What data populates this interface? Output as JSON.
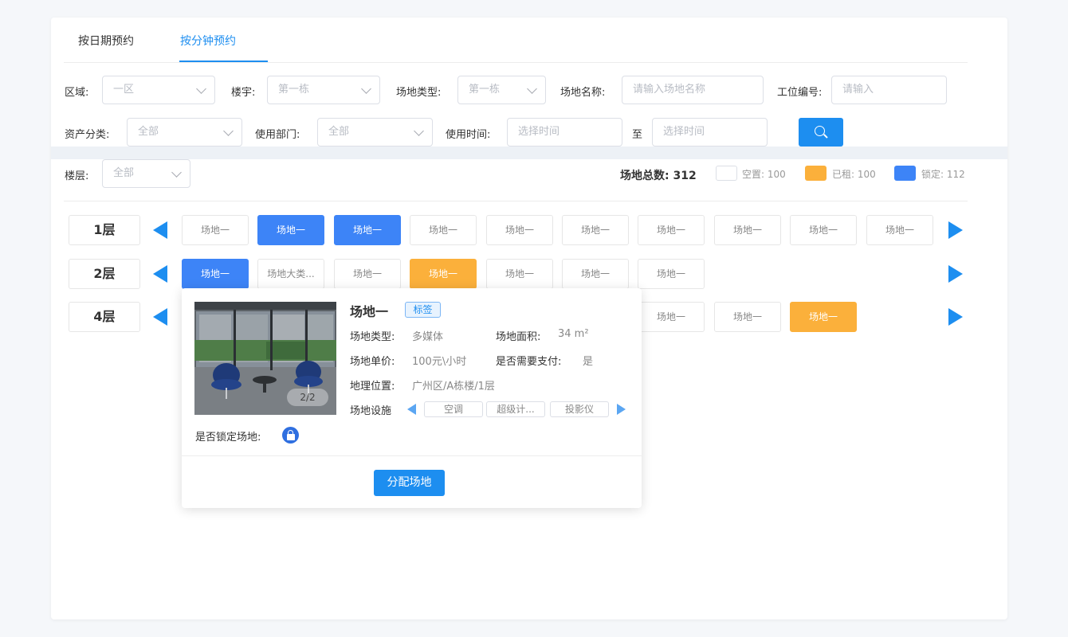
{
  "tabs": [
    "按日期预约",
    "按分钟预约"
  ],
  "filters": {
    "area": {
      "label": "区域:",
      "value": "一区"
    },
    "building": {
      "label": "楼宇:",
      "value": "第一栋"
    },
    "venue_type": {
      "label": "场地类型:",
      "value": "第一栋"
    },
    "venue_name": {
      "label": "场地名称:",
      "placeholder": "请输入场地名称"
    },
    "station_no": {
      "label": "工位编号:",
      "placeholder": "请输入"
    },
    "asset_class": {
      "label": "资产分类:",
      "value": "全部"
    },
    "department": {
      "label": "使用部门:",
      "value": "全部"
    },
    "use_time": {
      "label": "使用时间:",
      "start_placeholder": "选择时间",
      "to": "至",
      "end_placeholder": "选择时间"
    },
    "floor": {
      "label": "楼层:",
      "value": "全部"
    }
  },
  "icons": {
    "search": "search-icon",
    "lock": "lock-icon",
    "chevron": "chevron-down-icon"
  },
  "legend": {
    "total_label": "场地总数: 312",
    "free": "空置: 100",
    "rented": "已租: 100",
    "locked": "锁定: 112"
  },
  "colors": {
    "accent": "#1d8ef0",
    "locked": "#3d84f7",
    "rented": "#fbb03b",
    "free": "#ffffff"
  },
  "floors": [
    {
      "label": "1层",
      "rooms": [
        {
          "name": "场地一",
          "state": "free"
        },
        {
          "name": "场地一",
          "state": "locked"
        },
        {
          "name": "场地一",
          "state": "locked"
        },
        {
          "name": "场地一",
          "state": "free"
        },
        {
          "name": "场地一",
          "state": "free"
        },
        {
          "name": "场地一",
          "state": "free"
        },
        {
          "name": "场地一",
          "state": "free"
        },
        {
          "name": "场地一",
          "state": "free"
        },
        {
          "name": "场地一",
          "state": "free"
        },
        {
          "name": "场地一",
          "state": "free"
        }
      ]
    },
    {
      "label": "2层",
      "rooms": [
        {
          "name": "场地一",
          "state": "locked"
        },
        {
          "name": "场地大类...",
          "state": "free"
        },
        {
          "name": "场地一",
          "state": "free"
        },
        {
          "name": "场地一",
          "state": "rented"
        },
        {
          "name": "场地一",
          "state": "free"
        },
        {
          "name": "场地一",
          "state": "free"
        },
        {
          "name": "场地一",
          "state": "free"
        }
      ]
    },
    {
      "label": "4层",
      "rooms": [
        {
          "name": "场地一",
          "state": "free"
        },
        {
          "name": "场地一",
          "state": "free"
        },
        {
          "name": "场地一",
          "state": "rented"
        }
      ]
    }
  ],
  "popup": {
    "title": "场地一",
    "tag": "标签",
    "photo_count": "2/2",
    "type_label": "场地类型:",
    "type_value": "多媒体",
    "area_label": "场地面积:",
    "area_value": "34 m²",
    "price_label": "场地单价:",
    "price_value": "100元\\小时",
    "pay_label": "是否需要支付:",
    "pay_value": "是",
    "location_label": "地理位置:",
    "location_value": "广州区/A栋楼/1层",
    "facilities_label": "场地设施",
    "facilities": [
      "空调",
      "超级计...",
      "投影仪"
    ],
    "lock_label": "是否锁定场地:",
    "assign_button": "分配场地"
  }
}
